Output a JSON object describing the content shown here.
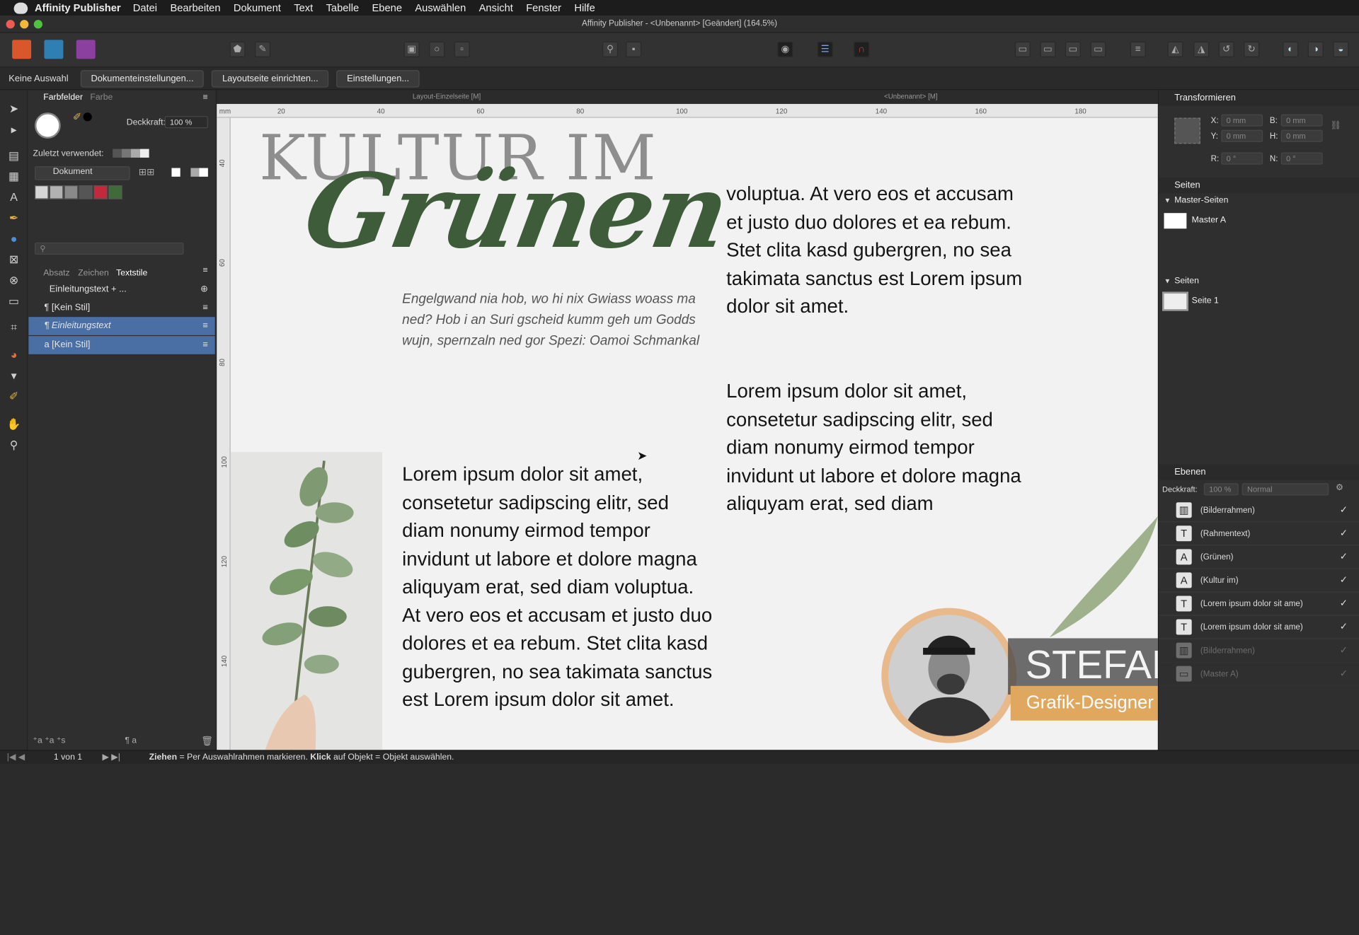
{
  "menubar": {
    "app": "Affinity Publisher",
    "items": [
      "Datei",
      "Bearbeiten",
      "Dokument",
      "Text",
      "Tabelle",
      "Ebene",
      "Auswählen",
      "Ansicht",
      "Fenster",
      "Hilfe"
    ]
  },
  "window": {
    "title": "Affinity Publisher - <Unbenannt> [Geändert] (164.5%)"
  },
  "context": {
    "selection": "Keine Auswahl",
    "buttons": [
      "Dokumenteinstellungen...",
      "Layoutseite einrichten...",
      "Einstellungen..."
    ]
  },
  "swatches": {
    "tab_active": "Farbfelder",
    "tab_other": "Farbe",
    "opacity_label": "Deckkraft:",
    "opacity_value": "100 %",
    "recent_label": "Zuletzt verwendet:",
    "palette": "Dokument",
    "colors": [
      "#d6d6d6",
      "#b2b2b2",
      "#8a8a8a",
      "#555555",
      "#c4283e",
      "#3f6b3a"
    ]
  },
  "textstyles": {
    "tabs": [
      "Absatz",
      "Zeichen",
      "Textstile"
    ],
    "group": "Einleitungstext + ...",
    "rows": [
      "[Kein Stil]",
      "Einleitungstext",
      "[Kein Stil]"
    ]
  },
  "doc": {
    "tab_left": "Layout-Einzelseite [M]",
    "tab_right": "<Unbenannt> [M]",
    "ruler_unit": "mm",
    "ruler_ticks": [
      "20",
      "40",
      "60",
      "80",
      "100",
      "120",
      "140",
      "160",
      "180"
    ],
    "vruler_ticks": [
      "40",
      "60",
      "80",
      "100",
      "120",
      "140"
    ]
  },
  "page": {
    "headline": "KULTUR IM",
    "script": "Grünen",
    "intro": "Engelgwand nia hob, wo hi nix Gwiass woass ma ned? Hob i an Suri gscheid kumm geh um Godds wujn, spernzaln ned gor Spezi: Oamoi Schmankal",
    "col1": "Lorem ipsum dolor sit amet, consetetur sadipscing elitr, sed diam nonumy eirmod tempor invidunt ut labore et dolore magna aliquyam erat, sed diam voluptua. At vero eos et accusam et justo duo dolores et ea rebum. Stet clita kasd gubergren, no sea takimata sanctus est Lorem ipsum dolor sit amet.",
    "col2a": "voluptua. At vero eos et accusam et justo duo dolores et ea rebum. Stet clita kasd gubergren, no sea takimata sanctus est Lorem ipsum dolor sit amet.",
    "col2b": "Lorem ipsum dolor sit amet, consetetur sadipscing elitr, sed diam nonumy eirmod tempor invidunt ut labore et dolore magna aliquyam erat, sed diam"
  },
  "overlay": {
    "name": "STEFAN RIEDL",
    "role": "Grafik-Designer"
  },
  "transform": {
    "title": "Transformieren",
    "x_label": "X:",
    "x": "0 mm",
    "y_label": "Y:",
    "y": "0 mm",
    "b_label": "B:",
    "b": "0 mm",
    "h_label": "H:",
    "h": "0 mm",
    "r_label": "R:",
    "r": "0 °",
    "n_label": "N:",
    "n": "0 °"
  },
  "pages": {
    "title": "Seiten",
    "master_header": "Master-Seiten",
    "master": "Master A",
    "pages_header": "Seiten",
    "page": "Seite 1"
  },
  "layers": {
    "title": "Ebenen",
    "opacity_label": "Deckkraft:",
    "opacity": "100 %",
    "blend": "Normal",
    "items": [
      "(Bilderrahmen)",
      "(Rahmentext)",
      "(Grünen)",
      "(Kultur im)",
      "(Lorem ipsum dolor sit ame)",
      "(Lorem ipsum dolor sit ame)",
      "(Bilderrahmen)",
      "(Master A)"
    ]
  },
  "status": {
    "page": "1 von 1",
    "hint_bold1": "Ziehen",
    "hint1": " = Per Auswahlrahmen markieren. ",
    "hint_bold2": "Klick",
    "hint2": " auf Objekt = Objekt auswählen."
  }
}
